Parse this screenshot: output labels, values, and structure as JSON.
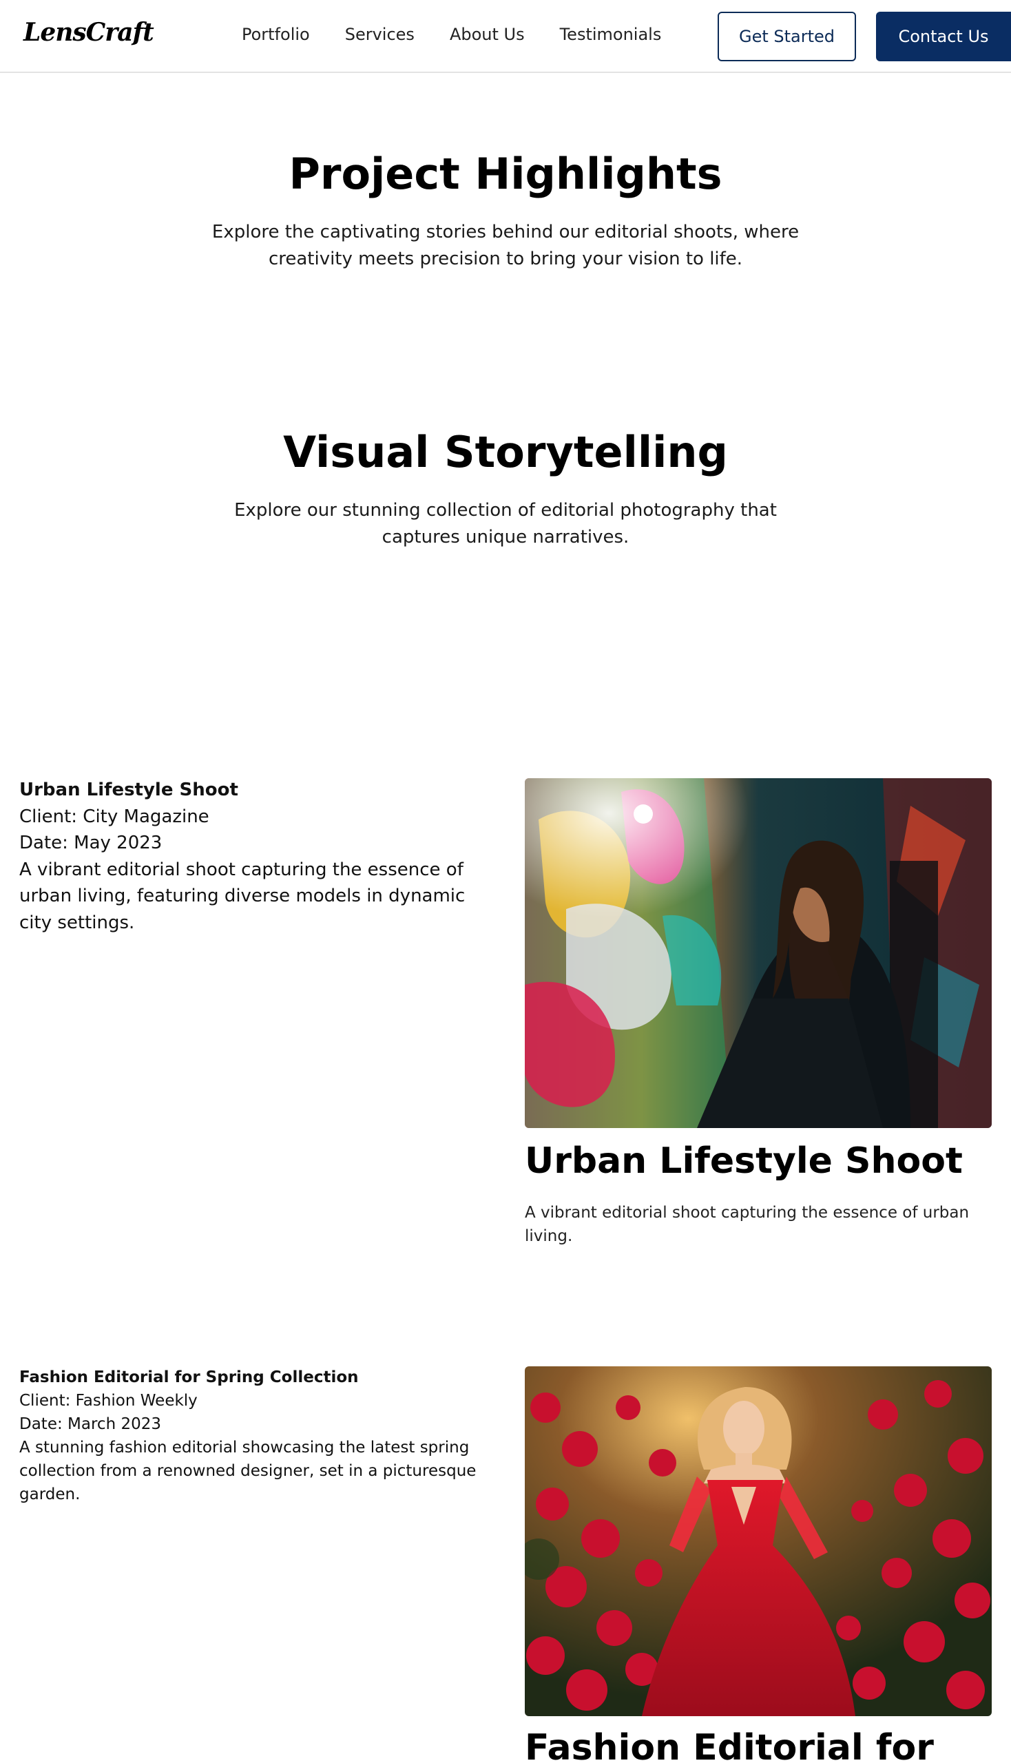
{
  "nav": {
    "logo": "LensCraft",
    "links": [
      "Portfolio",
      "Services",
      "About Us",
      "Testimonials"
    ],
    "get_started": "Get Started",
    "contact": "Contact Us",
    "accent_color": "#0a2d63"
  },
  "highlights": {
    "title": "Project Highlights",
    "subtitle": "Explore the captivating stories behind our editorial shoots, where creativity meets precision to bring your vision to life."
  },
  "storytelling": {
    "title": "Visual Storytelling",
    "subtitle": "Explore our stunning collection of editorial photography that captures unique narratives."
  },
  "projects": [
    {
      "name": "Urban Lifestyle Shoot",
      "client": "Client: City Magazine",
      "date": "Date: May 2023",
      "description": "A vibrant editorial shoot capturing the essence of urban living, featuring diverse models in dynamic city settings.",
      "card_title": "Urban Lifestyle Shoot",
      "card_description": "A vibrant editorial shoot capturing the essence of urban living.",
      "image": "woman in black jacket posing against colorful graffiti wall"
    },
    {
      "name": "Fashion Editorial for Spring Collection",
      "client": "Client: Fashion Weekly",
      "date": "Date: March 2023",
      "description": "A stunning fashion editorial showcasing the latest spring collection from a renowned designer, set in a picturesque garden.",
      "card_title": "Fashion Editorial for",
      "image": "woman in red dress standing among red roses at sunset"
    }
  ]
}
